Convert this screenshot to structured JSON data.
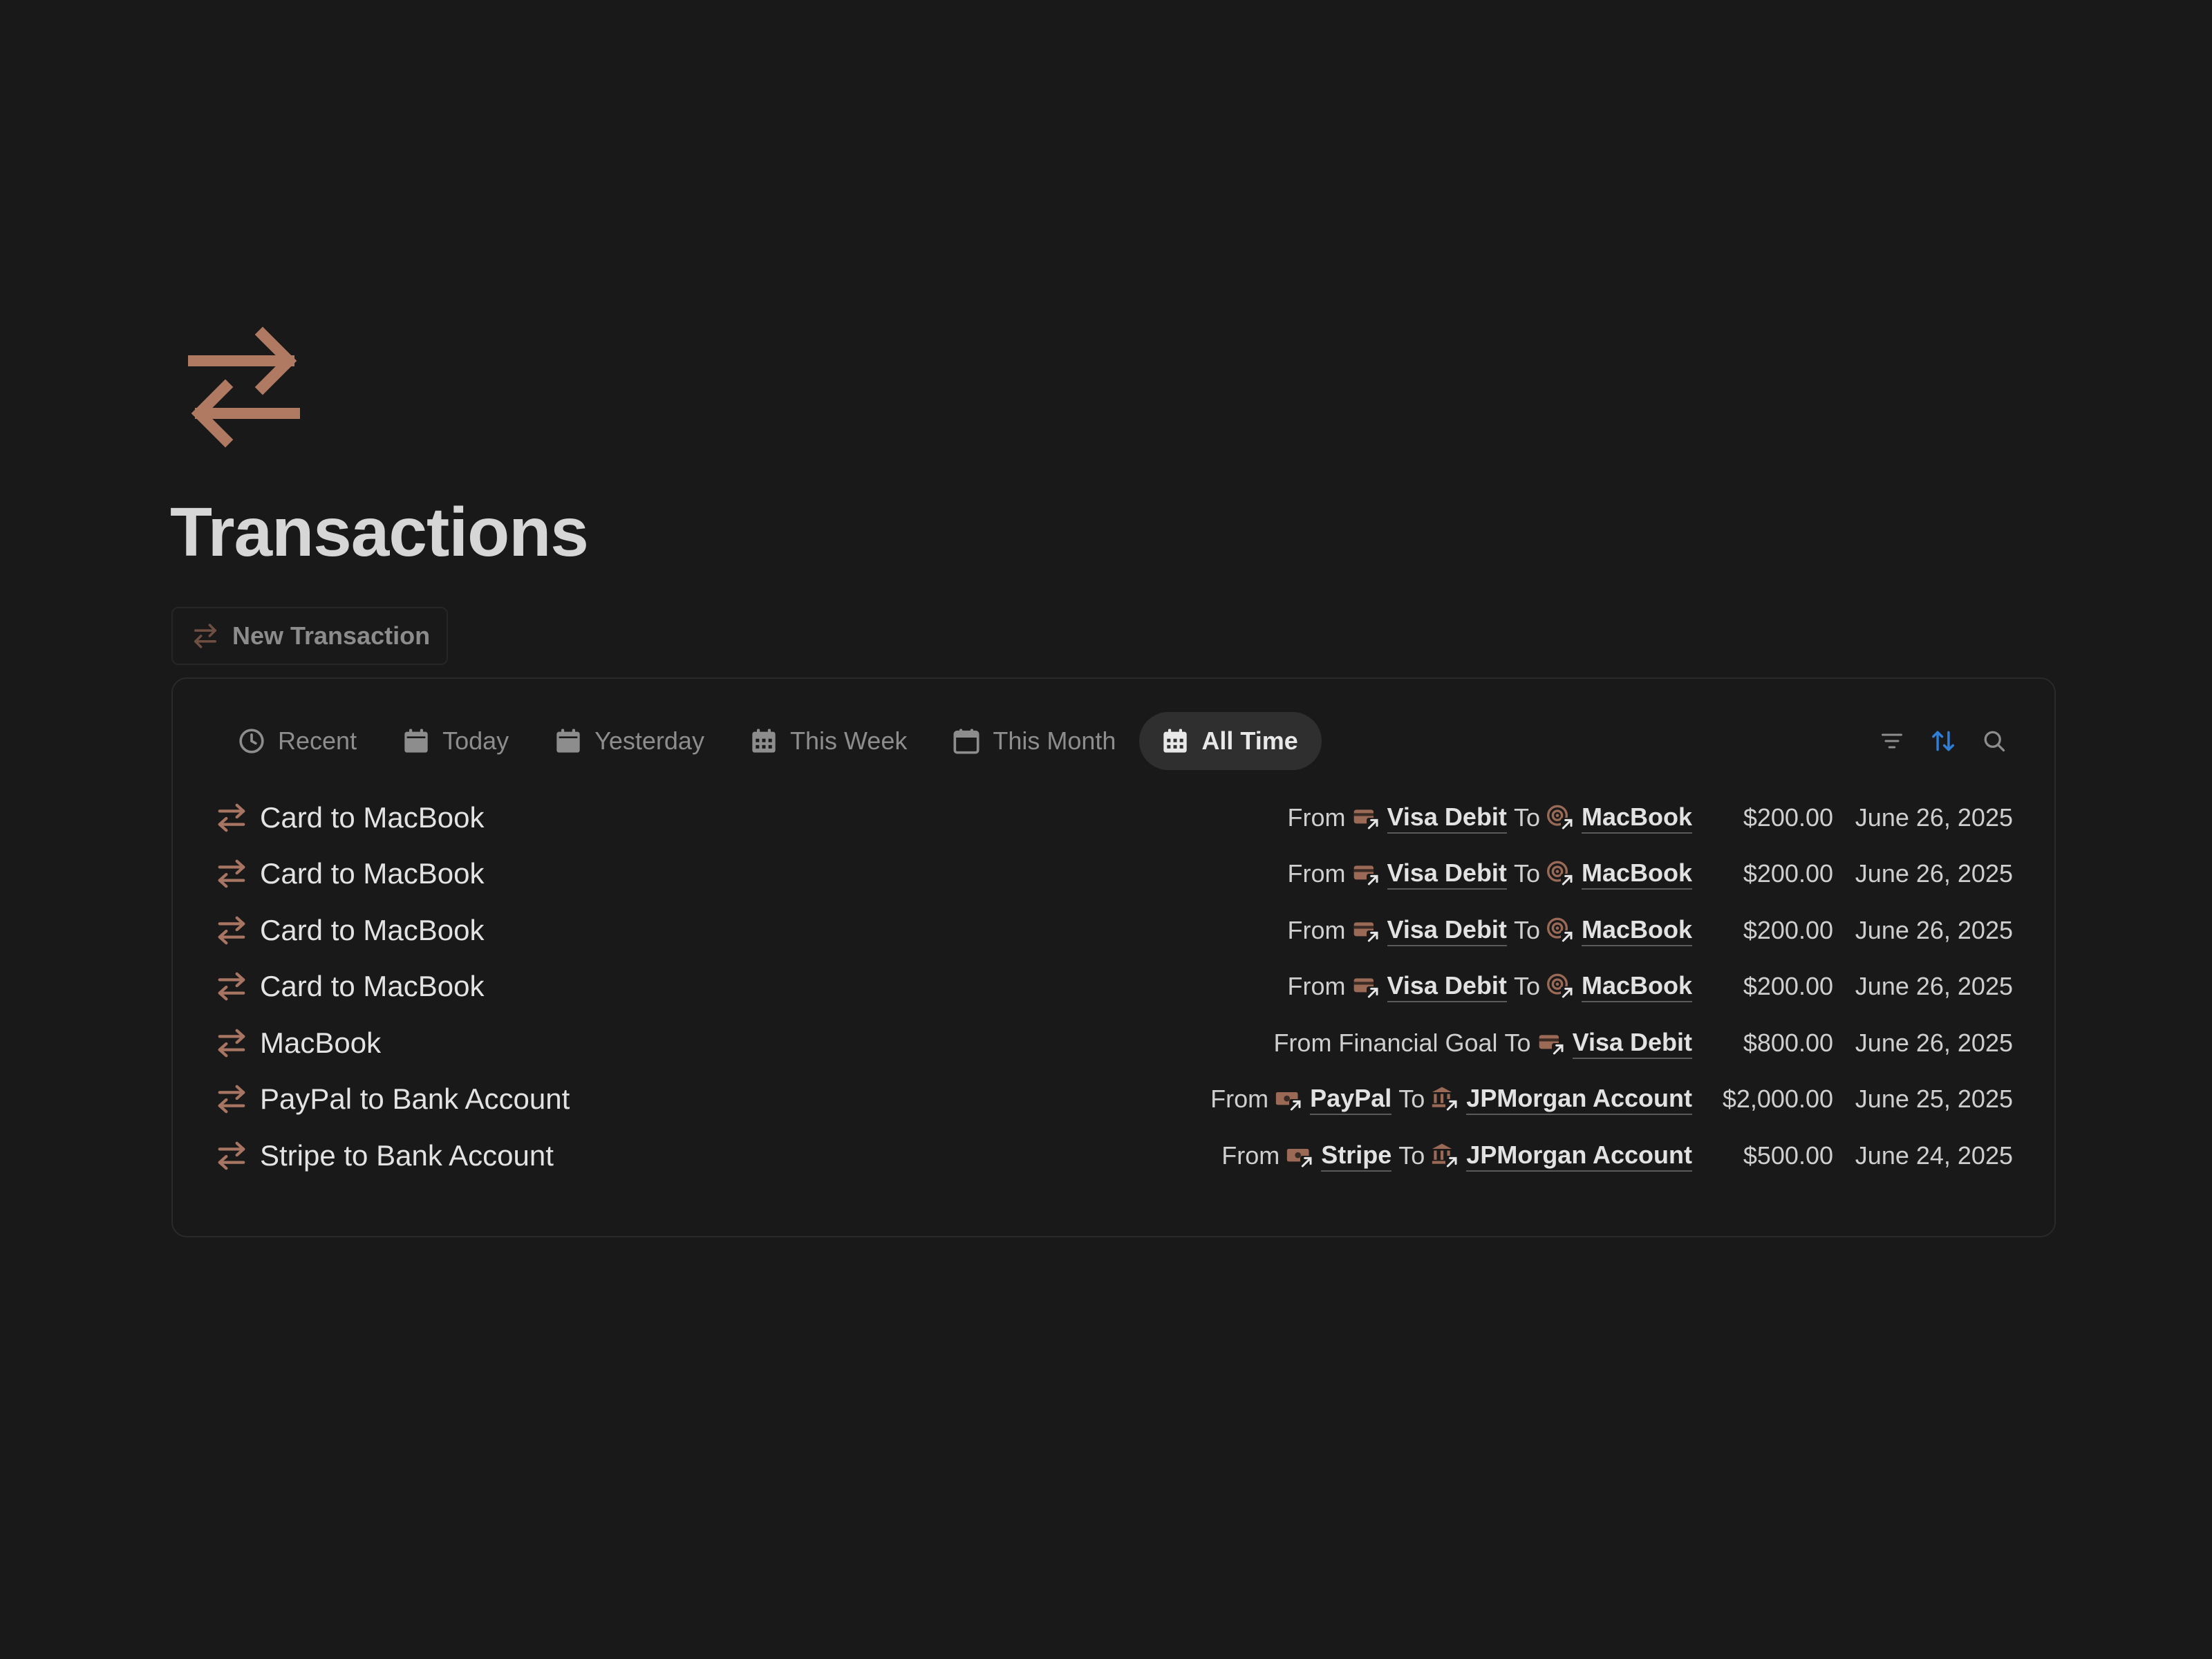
{
  "page": {
    "title": "Transactions",
    "new_button_label": "New Transaction"
  },
  "tabs": [
    {
      "label": "Recent",
      "icon": "clock-icon",
      "active": false
    },
    {
      "label": "Today",
      "icon": "calendar-icon",
      "active": false
    },
    {
      "label": "Yesterday",
      "icon": "calendar-icon",
      "active": false
    },
    {
      "label": "This Week",
      "icon": "calendar-grid-icon",
      "active": false
    },
    {
      "label": "This Month",
      "icon": "calendar-icon",
      "active": false
    },
    {
      "label": "All Time",
      "icon": "calendar-grid-icon",
      "active": true
    }
  ],
  "toolbar": {
    "filter_icon": "filter-icon",
    "sort_icon": "sort-icon",
    "search_icon": "search-icon"
  },
  "colors": {
    "accent": "#b07a62",
    "sort_active": "#2f7fd6",
    "background": "#191919"
  },
  "transactions": [
    {
      "name": "Card to MacBook",
      "from_word": "From",
      "from": "Visa Debit",
      "from_icon": "card-icon",
      "to_word": "To",
      "to": "MacBook",
      "to_icon": "target-icon",
      "amount": "$200.00",
      "date": "June 26, 2025"
    },
    {
      "name": "Card to MacBook",
      "from_word": "From",
      "from": "Visa Debit",
      "from_icon": "card-icon",
      "to_word": "To",
      "to": "MacBook",
      "to_icon": "target-icon",
      "amount": "$200.00",
      "date": "June 26, 2025"
    },
    {
      "name": "Card to MacBook",
      "from_word": "From",
      "from": "Visa Debit",
      "from_icon": "card-icon",
      "to_word": "To",
      "to": "MacBook",
      "to_icon": "target-icon",
      "amount": "$200.00",
      "date": "June 26, 2025"
    },
    {
      "name": "Card to MacBook",
      "from_word": "From",
      "from": "Visa Debit",
      "from_icon": "card-icon",
      "to_word": "To",
      "to": "MacBook",
      "to_icon": "target-icon",
      "amount": "$200.00",
      "date": "June 26, 2025"
    },
    {
      "name": "MacBook",
      "from_word": "From Financial Goal",
      "from": "",
      "from_icon": "",
      "to_word": "To",
      "to": "Visa Debit",
      "to_icon": "card-icon",
      "amount": "$800.00",
      "date": "June 26, 2025"
    },
    {
      "name": "PayPal to Bank Account",
      "from_word": "From",
      "from": "PayPal",
      "from_icon": "cash-icon",
      "to_word": "To",
      "to": "JPMorgan Account",
      "to_icon": "bank-icon",
      "amount": "$2,000.00",
      "date": "June 25, 2025"
    },
    {
      "name": "Stripe to Bank Account",
      "from_word": "From",
      "from": "Stripe",
      "from_icon": "cash-icon",
      "to_word": "To",
      "to": "JPMorgan Account",
      "to_icon": "bank-icon",
      "amount": "$500.00",
      "date": "June 24, 2025"
    }
  ]
}
